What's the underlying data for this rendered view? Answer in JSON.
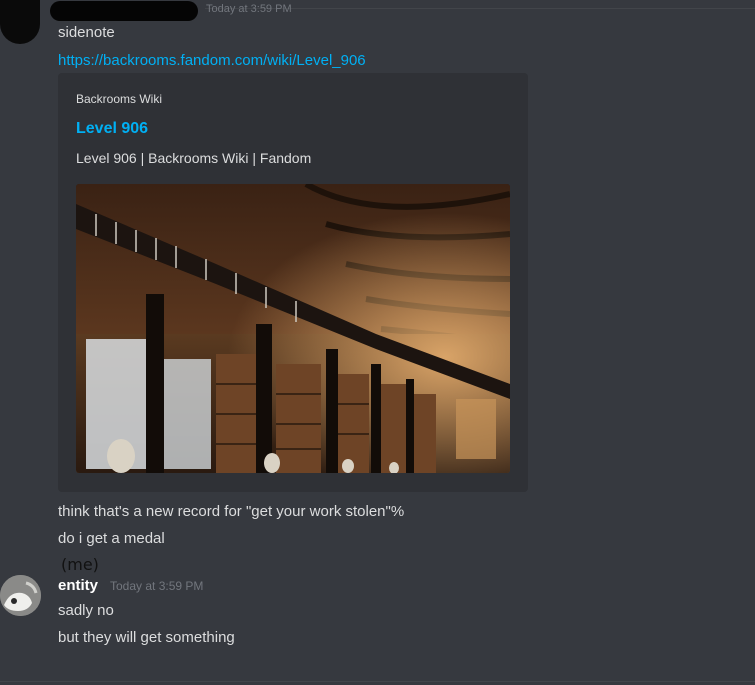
{
  "header_message": {
    "timestamp": "Today at 3:59 PM",
    "lines": {
      "sidenote": "sidenote",
      "link": "https://backrooms.fandom.com/wiki/Level_906"
    }
  },
  "embed": {
    "provider": "Backrooms Wiki",
    "title": "Level 906",
    "description": "Level 906 | Backrooms Wiki | Fandom",
    "image_alt": "Library hall with arched wooden ceiling"
  },
  "followup_messages": [
    "think that's a new record for \"get your work stolen\"%",
    "do i get a medal"
  ],
  "annotation": "(me)",
  "reply": {
    "username": "entity",
    "timestamp": "Today at 3:59 PM",
    "lines": [
      "sadly no",
      "but they will get something"
    ]
  },
  "colors": {
    "background": "#36393f",
    "embed_background": "#2f3136",
    "link": "#00b0f4",
    "text": "#dcddde",
    "timestamp": "#72767d"
  }
}
